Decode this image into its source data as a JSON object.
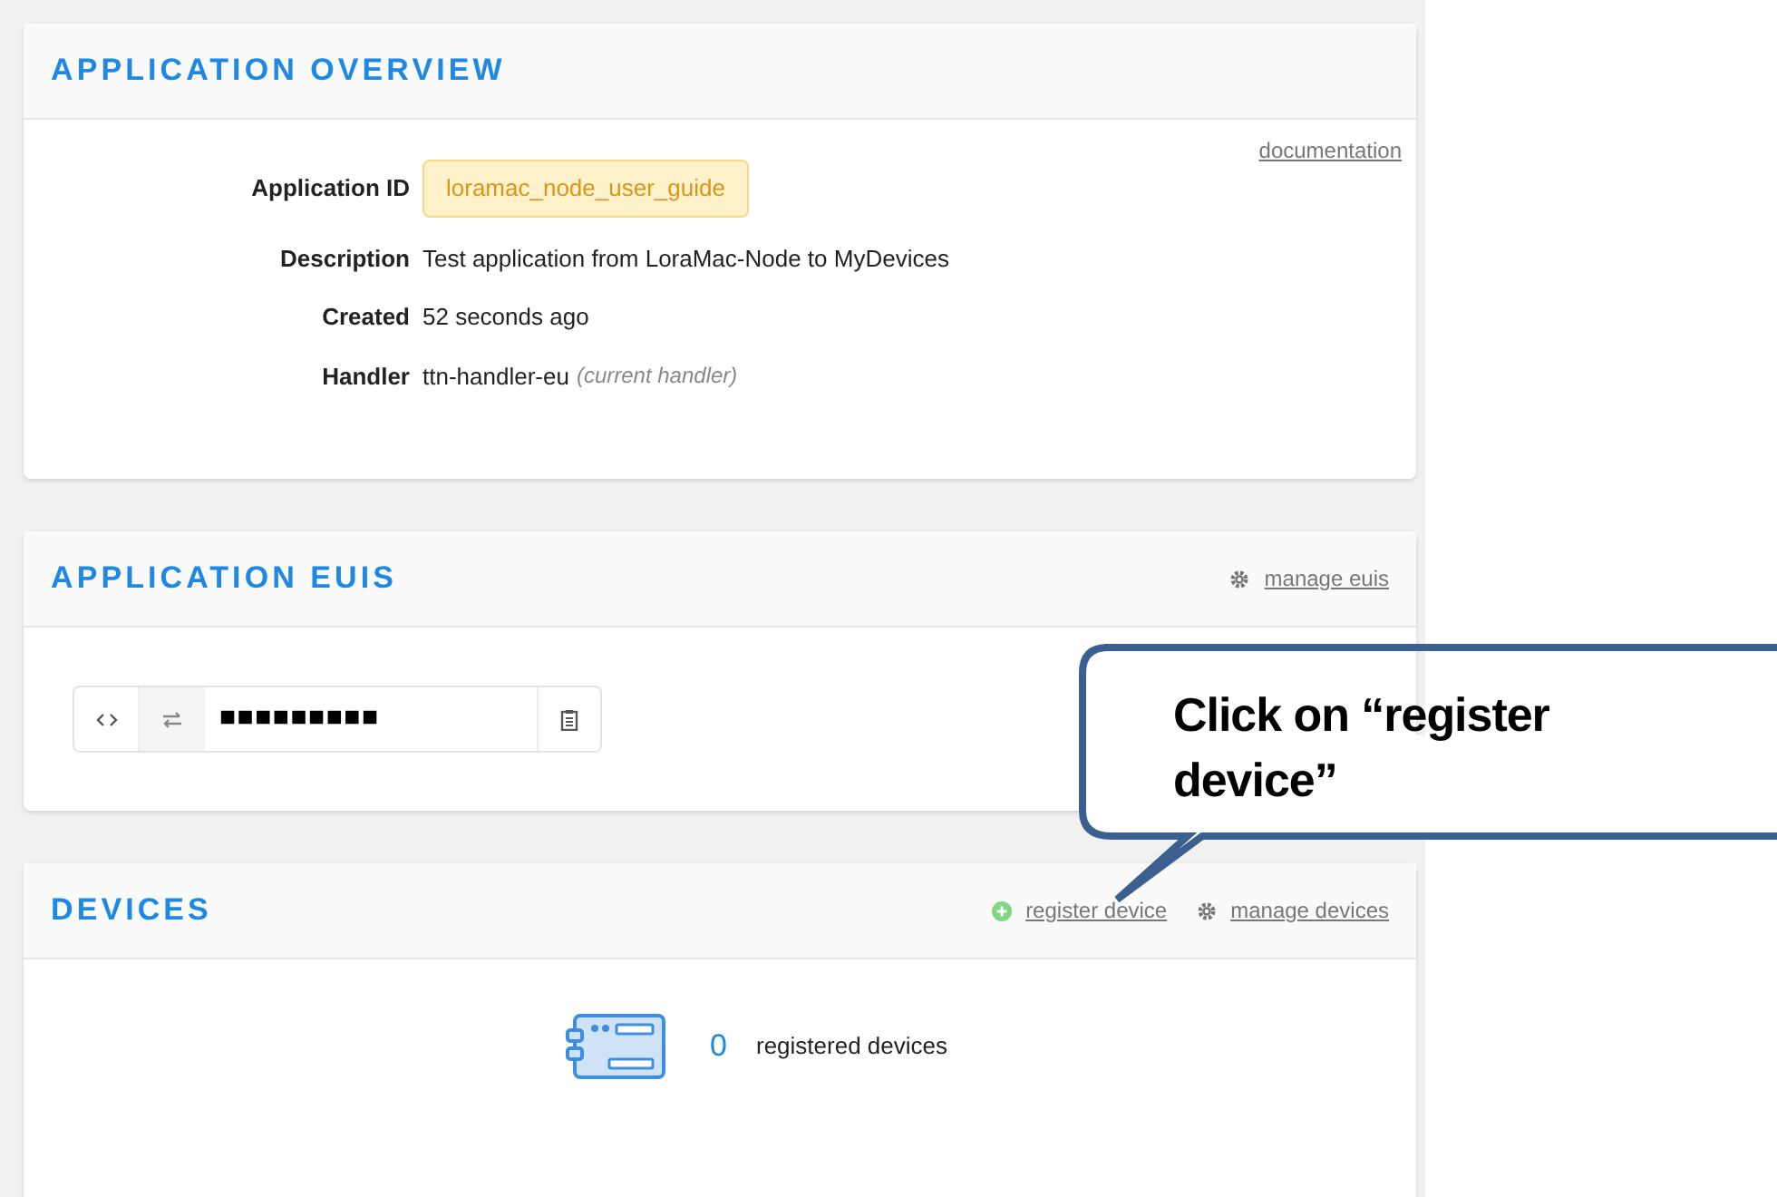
{
  "overview": {
    "title": "APPLICATION OVERVIEW",
    "link": "documentation",
    "fields": [
      {
        "label": "Application ID",
        "value": "loramac_node_user_guide",
        "kind": "badge"
      },
      {
        "label": "Description",
        "value": "Test application from LoraMac-Node to MyDevices",
        "kind": "text"
      },
      {
        "label": "Created",
        "value": "52 seconds ago",
        "kind": "text"
      },
      {
        "label": "Handler",
        "value": "ttn-handler-eu",
        "note": "(current handler)",
        "kind": "text"
      }
    ]
  },
  "euis": {
    "title": "APPLICATION EUIS",
    "link": "manage euis",
    "value": "■■■■■■■■■"
  },
  "devices": {
    "title": "DEVICES",
    "links": [
      {
        "label": "register device",
        "kind": "add"
      },
      {
        "label": "manage devices",
        "kind": "settings"
      }
    ],
    "count": "0",
    "count_label": "registered devices"
  },
  "callout": {
    "text": "Click on “register device”"
  }
}
